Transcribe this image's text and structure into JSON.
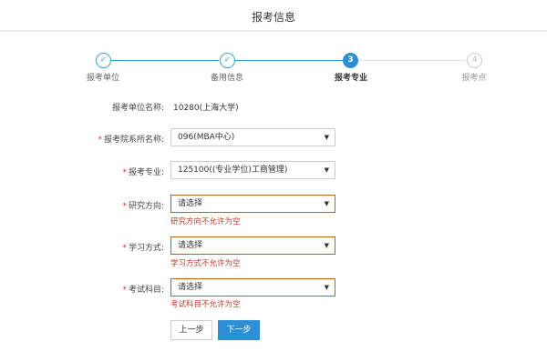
{
  "header": {
    "title": "报考信息"
  },
  "steps": [
    {
      "index": "✓",
      "label": "报考单位",
      "state": "done"
    },
    {
      "index": "✓",
      "label": "备用信息",
      "state": "done"
    },
    {
      "index": "3",
      "label": "报考专业",
      "state": "active"
    },
    {
      "index": "4",
      "label": "报考点",
      "state": "todo"
    }
  ],
  "form": {
    "unit": {
      "label": "报考单位名称:",
      "value": "10280(上海大学)"
    },
    "department": {
      "required": "*",
      "label": "报考院系所名称:",
      "value": "096(MBA中心)"
    },
    "major": {
      "required": "*",
      "label": "报考专业:",
      "value": "125100((专业学位)工商管理)"
    },
    "direction": {
      "required": "*",
      "label": "研究方向:",
      "value": "请选择",
      "error": "研究方向不允许为空"
    },
    "study_mode": {
      "required": "*",
      "label": "学习方式:",
      "value": "请选择",
      "error": "学习方式不允许为空"
    },
    "subjects": {
      "required": "*",
      "label": "考试科目:",
      "value": "请选择",
      "error": "考试科目不允许为空"
    }
  },
  "buttons": {
    "prev": "上一步",
    "next": "下一步"
  },
  "colors": {
    "primary": "#2c8fd6",
    "error": "#c0392b"
  }
}
